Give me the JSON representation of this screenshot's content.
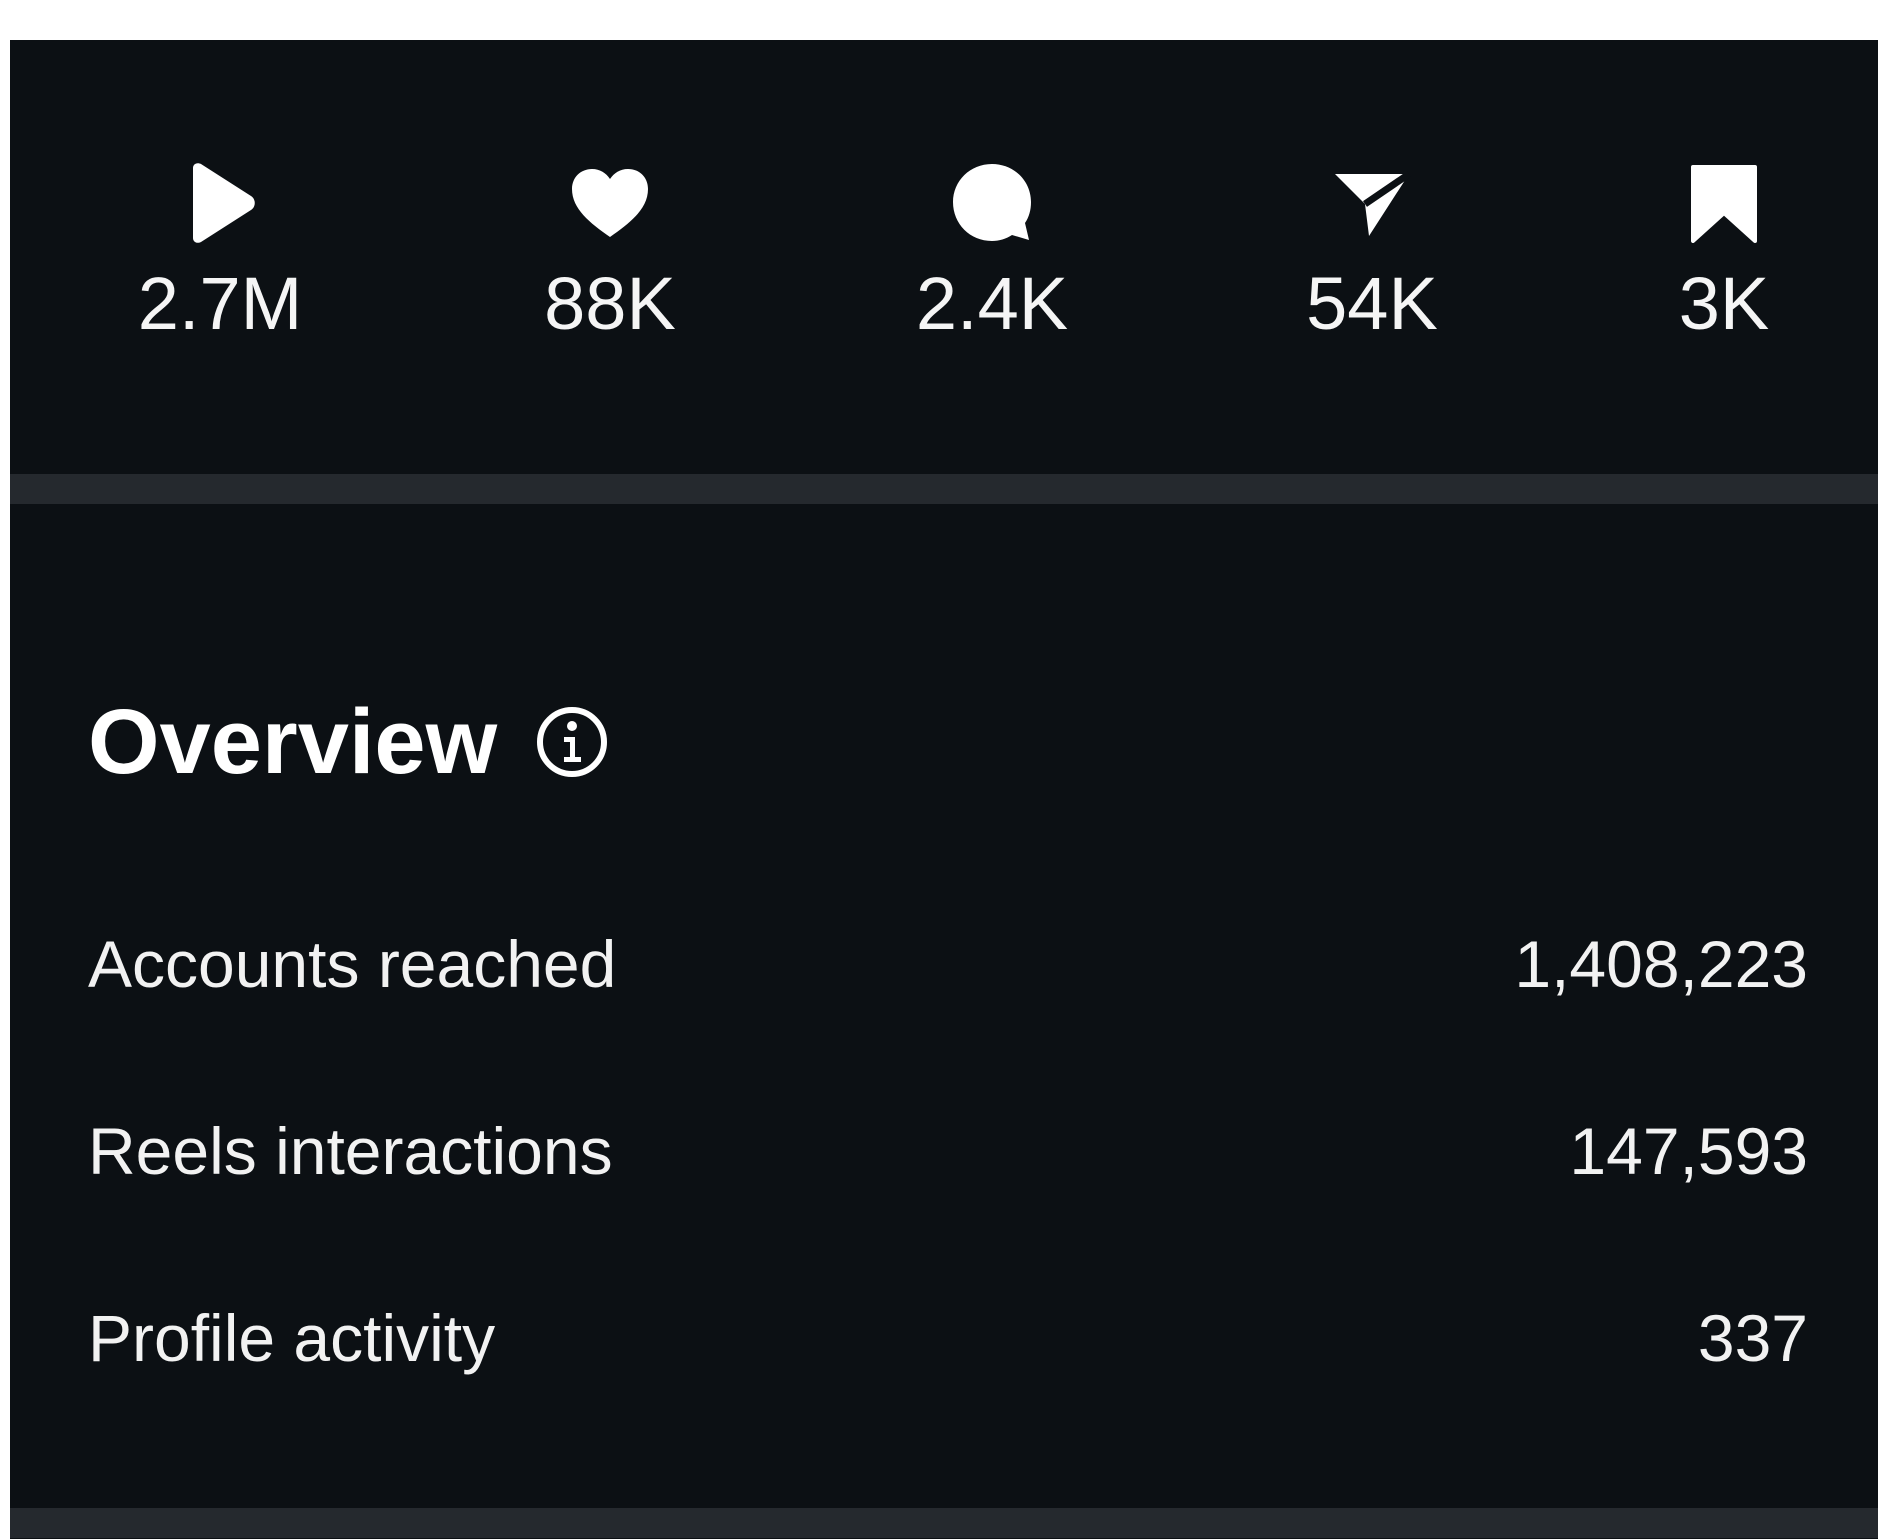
{
  "stats": [
    {
      "icon": "play-icon",
      "value": "2.7M"
    },
    {
      "icon": "heart-icon",
      "value": "88K"
    },
    {
      "icon": "comment-icon",
      "value": "2.4K"
    },
    {
      "icon": "share-icon",
      "value": "54K"
    },
    {
      "icon": "bookmark-icon",
      "value": "3K"
    }
  ],
  "overview": {
    "title": "Overview",
    "info_icon": "info-icon",
    "metrics": [
      {
        "label": "Accounts reached",
        "value": "1,408,223"
      },
      {
        "label": "Reels interactions",
        "value": "147,593"
      },
      {
        "label": "Profile activity",
        "value": "337"
      }
    ]
  },
  "colors": {
    "background": "#0c1014",
    "divider": "#25292e",
    "text": "#f5f5f5"
  }
}
